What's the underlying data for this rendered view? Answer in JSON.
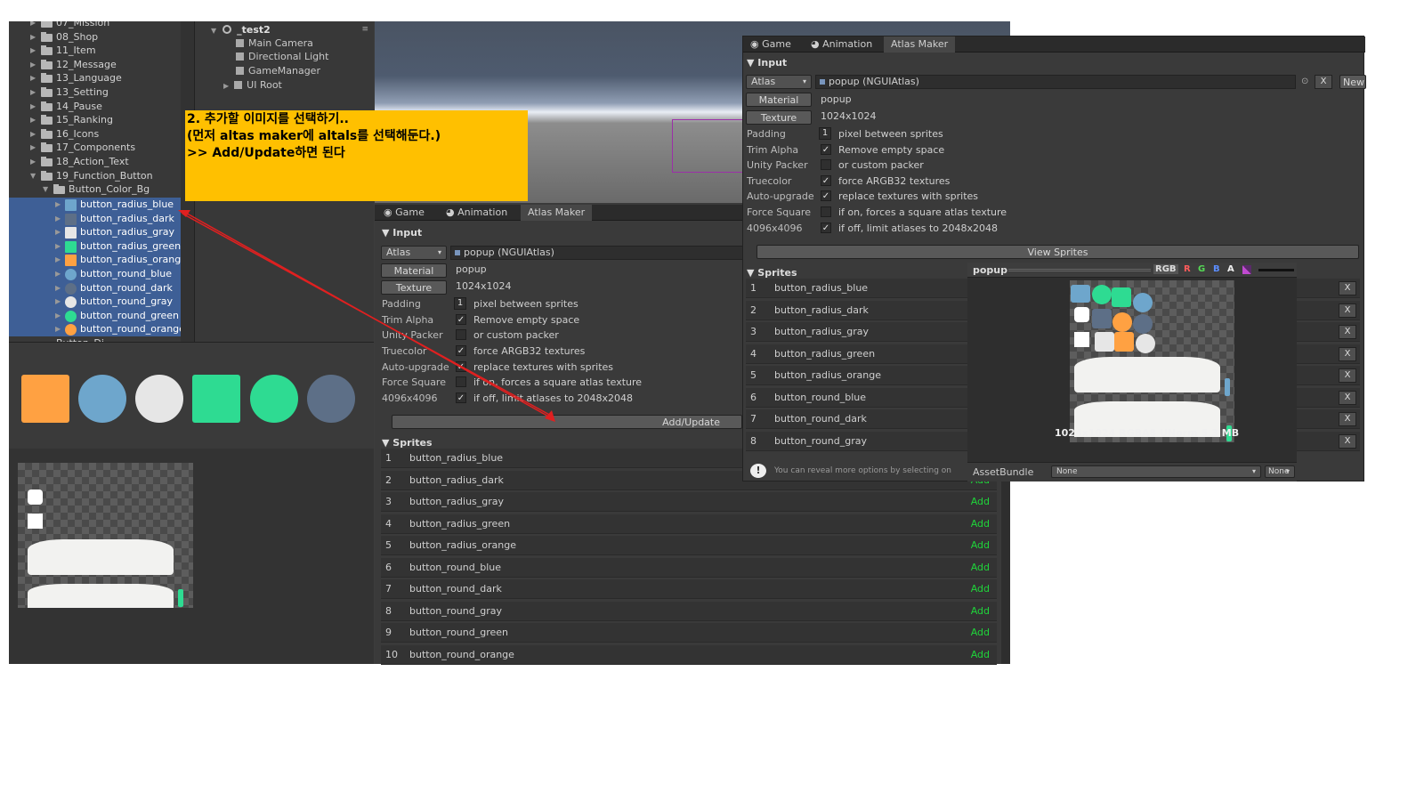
{
  "project_tree": {
    "items": [
      {
        "label": "07_Mission",
        "indent": 0
      },
      {
        "label": "08_Shop",
        "indent": 0
      },
      {
        "label": "11_Item",
        "indent": 0
      },
      {
        "label": "12_Message",
        "indent": 0
      },
      {
        "label": "13_Language",
        "indent": 0
      },
      {
        "label": "13_Setting",
        "indent": 0
      },
      {
        "label": "14_Pause",
        "indent": 0
      },
      {
        "label": "15_Ranking",
        "indent": 0
      },
      {
        "label": "16_Icons",
        "indent": 0
      },
      {
        "label": "17_Components",
        "indent": 0
      },
      {
        "label": "18_Action_Text",
        "indent": 0
      },
      {
        "label": "19_Function_Button",
        "indent": 0
      },
      {
        "label": "Button_Color_Bg",
        "indent": 1
      }
    ],
    "selected_sprites": [
      {
        "label": "button_radius_blue",
        "color": "#6ea6cc",
        "shape": "square"
      },
      {
        "label": "button_radius_dark",
        "color": "#5d6f87",
        "shape": "square"
      },
      {
        "label": "button_radius_gray",
        "color": "#e6e6e6",
        "shape": "square"
      },
      {
        "label": "button_radius_green",
        "color": "#2edb92",
        "shape": "square"
      },
      {
        "label": "button_radius_orange",
        "color": "#ffa142",
        "shape": "square"
      },
      {
        "label": "button_round_blue",
        "color": "#6ea6cc",
        "shape": "circle"
      },
      {
        "label": "button_round_dark",
        "color": "#5d6f87",
        "shape": "circle"
      },
      {
        "label": "button_round_gray",
        "color": "#e6e6e6",
        "shape": "circle"
      },
      {
        "label": "button_round_green",
        "color": "#2edb92",
        "shape": "circle"
      },
      {
        "label": "button_round_orange",
        "color": "#ffa142",
        "shape": "circle"
      }
    ],
    "partial_label": "Button_Di..."
  },
  "hierarchy": {
    "scene_name": "_test2",
    "items": [
      "Main Camera",
      "Directional Light",
      "GameManager",
      "UI Root"
    ]
  },
  "callout": {
    "line1": "2. 추가할 이미지를 선택하기..",
    "line2": "(먼저 altas maker에 altals를 선택해둔다.)",
    "line3": ">> Add/Update하면 된다"
  },
  "atlas_maker_middle": {
    "tabs": [
      "Game",
      "Animation",
      "Atlas Maker"
    ],
    "input_header": "Input",
    "atlas_label": "Atlas",
    "atlas_value": "popup (NGUIAtlas)",
    "material_label": "Material",
    "material_value": "popup",
    "texture_label": "Texture",
    "texture_value": "1024x1024",
    "padding_label": "Padding",
    "padding_value": "1",
    "padding_desc": "pixel between sprites",
    "trim_label": "Trim Alpha",
    "trim_desc": "Remove empty space",
    "unity_label": "Unity Packer",
    "unity_desc": "or custom packer",
    "truecolor_label": "Truecolor",
    "truecolor_desc": "force ARGB32 textures",
    "autoupgrade_label": "Auto-upgrade",
    "autoupgrade_desc": "replace textures with sprites",
    "forcesquare_label": "Force Square",
    "forcesquare_desc": "if on, forces a square atlas texture",
    "size_label": "4096x4096",
    "size_desc": "if off, limit atlases to 2048x2048",
    "add_update": "Add/Update",
    "sprites_header": "Sprites",
    "add_label": "Add",
    "sprites": [
      "button_radius_blue",
      "button_radius_dark",
      "button_radius_gray",
      "button_radius_green",
      "button_radius_orange",
      "button_round_blue",
      "button_round_dark",
      "button_round_gray",
      "button_round_green",
      "button_round_orange"
    ]
  },
  "atlas_maker_right": {
    "tabs": [
      "Game",
      "Animation",
      "Atlas Maker"
    ],
    "input_header": "Input",
    "new_button": "New",
    "x_button": "X",
    "view_sprites": "View Sprites",
    "sprites_header": "Sprites",
    "preview_title": "popup",
    "channels": [
      "RGB",
      "R",
      "G",
      "B",
      "A"
    ],
    "preview_info": "1024x1024  RGBA8 UNorm  5.3 MB",
    "hint": "You can reveal more options by selecting on",
    "assetbundle_label": "AssetBundle",
    "assetbundle_value": "None",
    "assetbundle_variant": "None",
    "sprites": [
      "button_radius_blue",
      "button_radius_dark",
      "button_radius_gray",
      "button_radius_green",
      "button_radius_orange",
      "button_round_blue",
      "button_round_dark",
      "button_round_gray"
    ]
  },
  "colors": {
    "accent_selection": "#3e5f96",
    "add_green": "#1fd63a",
    "callout_bg": "#ffc000",
    "arrow_red": "#e02020"
  }
}
